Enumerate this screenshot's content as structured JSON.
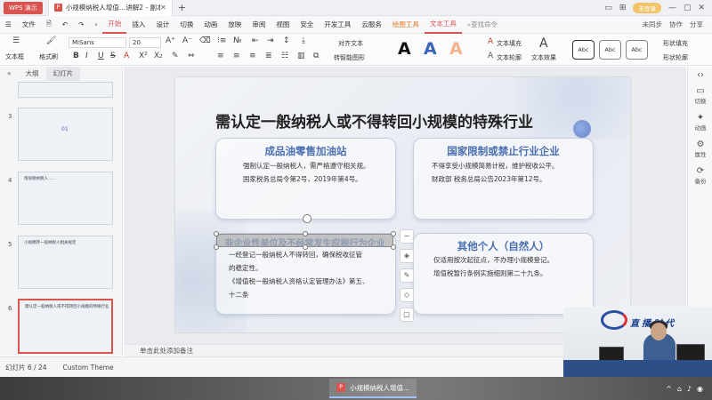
{
  "titlebar": {
    "app_name": "WPS 演示",
    "doc_tab": "小规模纳税人增值…讲解2 - 副本",
    "right_user": "未登录"
  },
  "menu": {
    "file": "文件",
    "items": [
      "开始",
      "插入",
      "设计",
      "切换",
      "动画",
      "放映",
      "审阅",
      "视图",
      "安全",
      "开发工具",
      "云服务"
    ],
    "active": "开始",
    "drawing_tools": "绘图工具",
    "text_tools": "文本工具",
    "search": "查找命令",
    "right": [
      "未同步",
      "协作",
      "分享"
    ]
  },
  "ribbon": {
    "textbox": "文本框",
    "format_brush": "格式刷",
    "font_name": "MiSans",
    "font_size": "20",
    "align_text": "对齐文本",
    "convert_smartart": "转智能图形",
    "text_fill": "文本填充",
    "text_outline": "文本轮廓",
    "text_effect": "文本效果",
    "shape_fill": "形状填充",
    "shape_outline": "形状轮廓",
    "style_label": "Abc",
    "big_a": "A"
  },
  "left_panel": {
    "tabs": [
      "大纲",
      "幻灯片"
    ],
    "active_tab": "幻灯片",
    "thumbs": [
      {
        "num": "3",
        "title": "01"
      },
      {
        "num": "4",
        "title": "增值税纳税人……"
      },
      {
        "num": "5",
        "title": "小规模转一般纳税人相关规定"
      },
      {
        "num": "6",
        "title": "需认定一般纳税人或不得转回小规模的特殊行业"
      }
    ]
  },
  "slide": {
    "title": "需认定一般纳税人或不得转回小规模的特殊行业",
    "cards": [
      {
        "title": "成品油零售加油站",
        "body": [
          "强制认定一般纳税人，需严格遵守相关规。",
          "国家税务总局令第2号，2019年第4号。"
        ]
      },
      {
        "title": "国家限制或禁止行业企业",
        "body": [
          "不得享受小规模简易计税，维护税收公平。",
          "财政部 税务总局公告2023年第12号。"
        ]
      },
      {
        "title": "非企业性单位及不经常发生应税行为企业",
        "body": [
          "一经登记一般纳税人不得转回，确保税收征管",
          "的稳定性。",
          "《增值税一般纳税人资格认定管理办法》第五、",
          "十二条"
        ]
      },
      {
        "title": "其他个人（自然人）",
        "body": [
          "仅适用按次起征点，不办理小规模登记。",
          "增值税暂行条例实施细则第二十九条。"
        ]
      }
    ]
  },
  "right_panel": [
    "切换",
    "动画",
    "属性",
    "备份"
  ],
  "notes": {
    "placeholder": "单击此处添加备注"
  },
  "status": {
    "slide_info": "幻灯片 6 / 24",
    "theme": "Custom Theme",
    "notes_btn": "备注",
    "comment_btn": "批注"
  },
  "taskbar": {
    "item": "小规模纳税人增值..."
  },
  "webcam": {
    "logo_text": "直播时代"
  }
}
